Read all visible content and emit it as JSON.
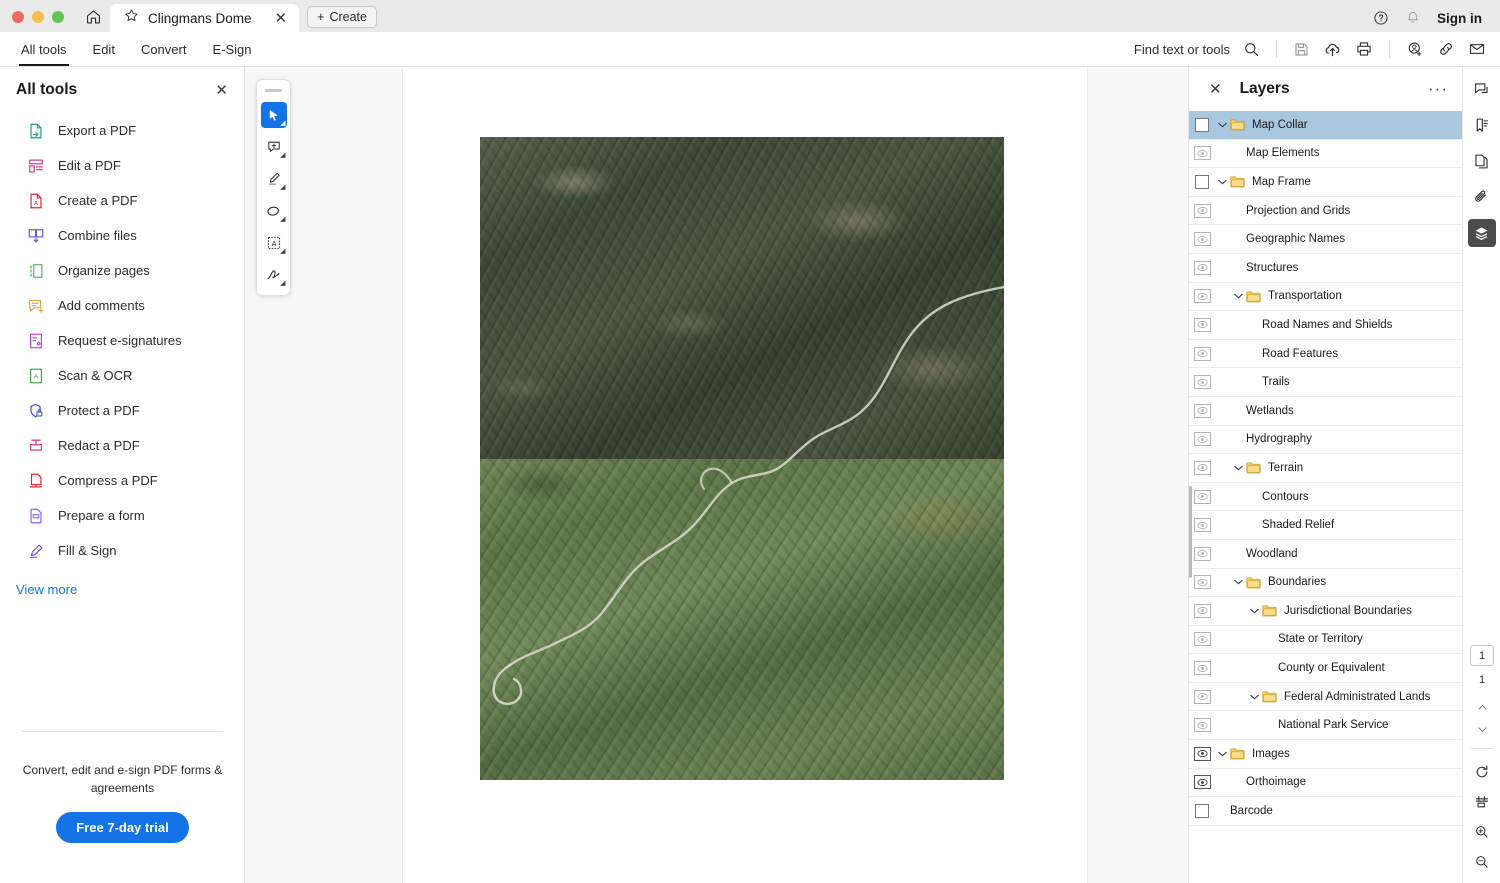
{
  "window": {
    "home_icon": "home-icon",
    "tab": {
      "favicon": "star-icon",
      "title": "Clingmans Dome",
      "close": "✕"
    },
    "create_button": {
      "plus": "+",
      "label": "Create"
    },
    "help_icon": "help-circle-icon",
    "bell_icon": "bell-icon",
    "signin_label": "Sign in"
  },
  "menubar": {
    "items": [
      {
        "label": "All tools",
        "active": true
      },
      {
        "label": "Edit",
        "active": false
      },
      {
        "label": "Convert",
        "active": false
      },
      {
        "label": "E-Sign",
        "active": false
      }
    ],
    "find_label": "Find text or tools",
    "icons": [
      "search-icon",
      "save-icon",
      "cloud-upload-icon",
      "print-icon",
      "add-person-icon",
      "link-icon",
      "mail-icon"
    ]
  },
  "sidebar": {
    "title": "All tools",
    "close": "✕",
    "tools": [
      {
        "label": "Export a PDF",
        "icon": "export-pdf-icon",
        "color": "#189c8f"
      },
      {
        "label": "Edit a PDF",
        "icon": "edit-pdf-icon",
        "color": "#d8438a"
      },
      {
        "label": "Create a PDF",
        "icon": "create-pdf-icon",
        "color": "#e8242a"
      },
      {
        "label": "Combine files",
        "icon": "combine-files-icon",
        "color": "#5b5bd6"
      },
      {
        "label": "Organize pages",
        "icon": "organize-pages-icon",
        "color": "#4fb74f"
      },
      {
        "label": "Add comments",
        "icon": "add-comments-icon",
        "color": "#e8a33d"
      },
      {
        "label": "Request e-signatures",
        "icon": "request-esign-icon",
        "color": "#c840c8"
      },
      {
        "label": "Scan & OCR",
        "icon": "scan-ocr-icon",
        "color": "#3ea34a"
      },
      {
        "label": "Protect a PDF",
        "icon": "protect-pdf-icon",
        "color": "#3b4fd8"
      },
      {
        "label": "Redact a PDF",
        "icon": "redact-pdf-icon",
        "color": "#e0408a"
      },
      {
        "label": "Compress a PDF",
        "icon": "compress-pdf-icon",
        "color": "#e8242a"
      },
      {
        "label": "Prepare a form",
        "icon": "prepare-form-icon",
        "color": "#8b5cf6"
      },
      {
        "label": "Fill & Sign",
        "icon": "fill-sign-icon",
        "color": "#7c4dd8"
      }
    ],
    "view_more": "View more",
    "promo_text": "Convert, edit and e-sign PDF forms & agreements",
    "promo_button": "Free 7-day trial",
    "promo_color": "#1473e6"
  },
  "annotation_toolbar": {
    "tools": [
      {
        "name": "select-tool",
        "active": true
      },
      {
        "name": "comment-tool",
        "active": false
      },
      {
        "name": "highlight-tool",
        "active": false
      },
      {
        "name": "draw-tool",
        "active": false
      },
      {
        "name": "text-box-tool",
        "active": false
      },
      {
        "name": "signature-tool",
        "active": false
      }
    ],
    "active_color": "#1473e6"
  },
  "document": {
    "image_alt": "orthoimage-aerial-terrain",
    "top_tone": "#414c39",
    "bottom_tone": "#637c4c"
  },
  "layers_panel": {
    "close": "✕",
    "title": "Layers",
    "more": "···",
    "selected_color": "#a8c6de",
    "rows": [
      {
        "label": "Map Collar",
        "indent": 0,
        "ctrl": "checkbox",
        "checked": false,
        "caret": true,
        "folder": true,
        "selected": true
      },
      {
        "label": "Map Elements",
        "indent": 1,
        "ctrl": "eye",
        "visible": false,
        "caret": false,
        "folder": false,
        "selected": false
      },
      {
        "label": "Map Frame",
        "indent": 0,
        "ctrl": "checkbox",
        "checked": false,
        "caret": true,
        "folder": true,
        "selected": false
      },
      {
        "label": "Projection and Grids",
        "indent": 1,
        "ctrl": "eye",
        "visible": false,
        "caret": false,
        "folder": false,
        "selected": false
      },
      {
        "label": "Geographic Names",
        "indent": 1,
        "ctrl": "eye",
        "visible": false,
        "caret": false,
        "folder": false,
        "selected": false
      },
      {
        "label": "Structures",
        "indent": 1,
        "ctrl": "eye",
        "visible": false,
        "caret": false,
        "folder": false,
        "selected": false
      },
      {
        "label": "Transportation",
        "indent": 1,
        "ctrl": "eye",
        "visible": false,
        "caret": true,
        "folder": true,
        "selected": false
      },
      {
        "label": "Road Names and Shields",
        "indent": 2,
        "ctrl": "eye",
        "visible": false,
        "caret": false,
        "folder": false,
        "selected": false
      },
      {
        "label": "Road Features",
        "indent": 2,
        "ctrl": "eye",
        "visible": false,
        "caret": false,
        "folder": false,
        "selected": false
      },
      {
        "label": "Trails",
        "indent": 2,
        "ctrl": "eye",
        "visible": false,
        "caret": false,
        "folder": false,
        "selected": false
      },
      {
        "label": "Wetlands",
        "indent": 1,
        "ctrl": "eye",
        "visible": false,
        "caret": false,
        "folder": false,
        "selected": false
      },
      {
        "label": "Hydrography",
        "indent": 1,
        "ctrl": "eye",
        "visible": false,
        "caret": false,
        "folder": false,
        "selected": false
      },
      {
        "label": "Terrain",
        "indent": 1,
        "ctrl": "eye",
        "visible": false,
        "caret": true,
        "folder": true,
        "selected": false
      },
      {
        "label": "Contours",
        "indent": 2,
        "ctrl": "eye",
        "visible": false,
        "caret": false,
        "folder": false,
        "selected": false
      },
      {
        "label": "Shaded Relief",
        "indent": 2,
        "ctrl": "eye",
        "visible": false,
        "caret": false,
        "folder": false,
        "selected": false
      },
      {
        "label": "Woodland",
        "indent": 1,
        "ctrl": "eye",
        "visible": false,
        "caret": false,
        "folder": false,
        "selected": false
      },
      {
        "label": "Boundaries",
        "indent": 1,
        "ctrl": "eye",
        "visible": false,
        "caret": true,
        "folder": true,
        "selected": false
      },
      {
        "label": "Jurisdictional Boundaries",
        "indent": 2,
        "ctrl": "eye",
        "visible": false,
        "caret": true,
        "folder": true,
        "selected": false
      },
      {
        "label": "State or Territory",
        "indent": 3,
        "ctrl": "eye",
        "visible": false,
        "caret": false,
        "folder": false,
        "selected": false
      },
      {
        "label": "County or Equivalent",
        "indent": 3,
        "ctrl": "eye",
        "visible": false,
        "caret": false,
        "folder": false,
        "selected": false
      },
      {
        "label": "Federal Administrated Lands",
        "indent": 2,
        "ctrl": "eye",
        "visible": false,
        "caret": true,
        "folder": true,
        "selected": false
      },
      {
        "label": "National Park Service",
        "indent": 3,
        "ctrl": "eye",
        "visible": false,
        "caret": false,
        "folder": false,
        "selected": false
      },
      {
        "label": "Images",
        "indent": 0,
        "ctrl": "eye",
        "visible": true,
        "caret": true,
        "folder": true,
        "selected": false
      },
      {
        "label": "Orthoimage",
        "indent": 1,
        "ctrl": "eye",
        "visible": true,
        "caret": false,
        "folder": false,
        "selected": false
      },
      {
        "label": "Barcode",
        "indent": 0,
        "ctrl": "checkbox",
        "checked": false,
        "caret": false,
        "folder": false,
        "selected": false
      }
    ]
  },
  "right_rail": {
    "top_icons": [
      {
        "name": "comment-icon",
        "active": false
      },
      {
        "name": "bookmark-icon",
        "active": false
      },
      {
        "name": "pages-icon",
        "active": false
      },
      {
        "name": "attachment-icon",
        "active": false
      },
      {
        "name": "layers-icon",
        "active": true
      }
    ],
    "page_current": "1",
    "page_total": "1",
    "prev_label": "⌃",
    "next_label": "⌄",
    "bottom_icons": [
      "rotate-icon",
      "fit-page-icon",
      "zoom-in-icon",
      "zoom-out-icon"
    ]
  }
}
